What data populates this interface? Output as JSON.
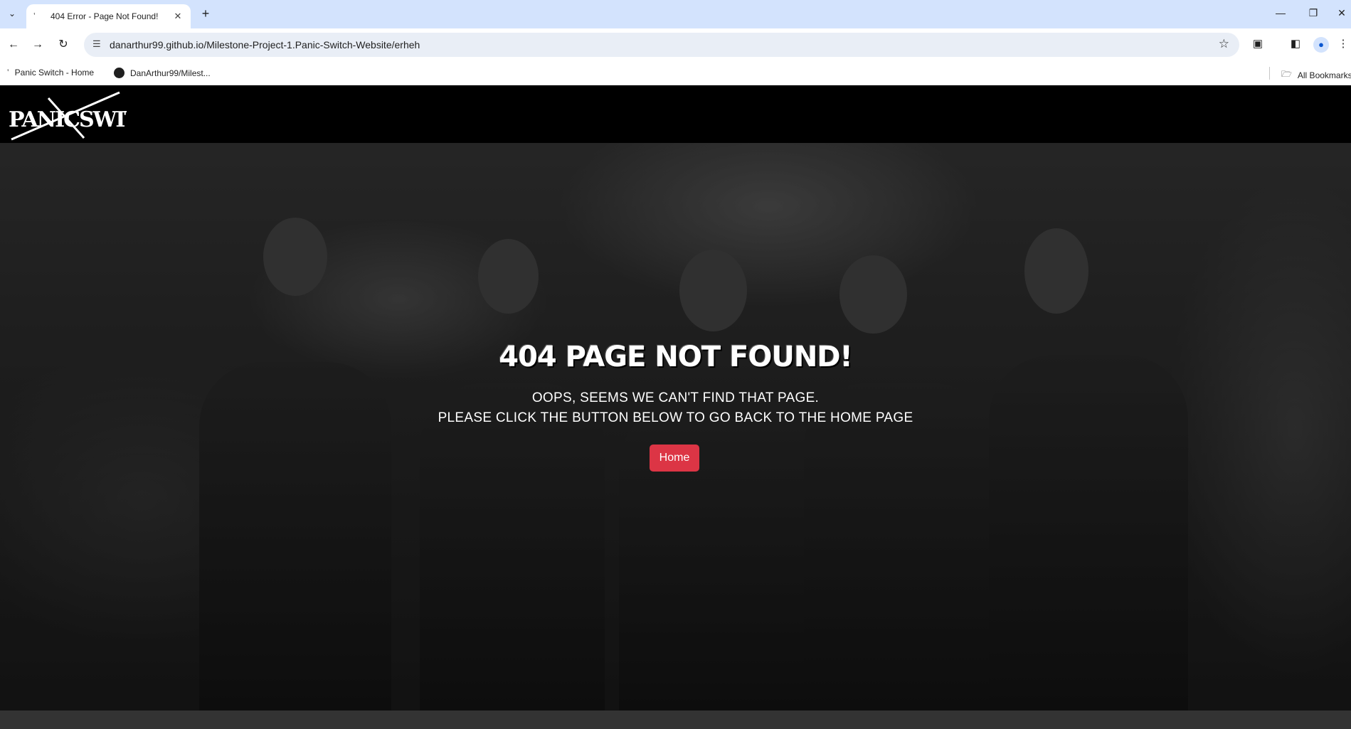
{
  "browser": {
    "tab_title": "404 Error - Page Not Found!",
    "url": "danarthur99.github.io/Milestone-Project-1.Panic-Switch-Website/erheh",
    "bookmarks": [
      {
        "label": "Panic Switch - Home"
      },
      {
        "label": "DanArthur99/Milest..."
      }
    ],
    "all_bookmarks_label": "All Bookmarks"
  },
  "site": {
    "logo_text": "PANICSWITCH"
  },
  "hero": {
    "title": "404 PAGE NOT FOUND!",
    "line1": "OOPS, SEEMS WE CAN'T FIND THAT PAGE.",
    "line2": "PLEASE CLICK THE BUTTON BELOW TO GO BACK TO THE HOME PAGE",
    "button_label": "Home"
  },
  "colors": {
    "button": "#dc3545",
    "header_bg": "#000000",
    "tabstrip": "#d3e3fd"
  }
}
